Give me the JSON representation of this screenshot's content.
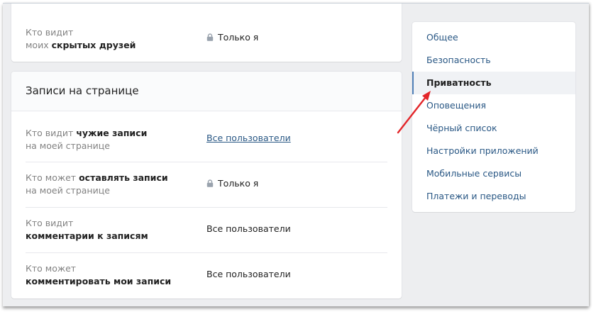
{
  "top_section": {
    "row": {
      "label_line1": "Кто видит",
      "label_prefix": "моих",
      "label_bold": "скрытых друзей",
      "value": "Только я",
      "value_icon": "lock-icon"
    }
  },
  "posts_section": {
    "title": "Записи на странице",
    "rows": [
      {
        "line1_prefix": "Кто видит",
        "line1_bold": "чужие записи",
        "line2": "на моей странице",
        "value": "Все пользователи",
        "value_style": "link"
      },
      {
        "line1_prefix": "Кто может",
        "line1_bold": "оставлять записи",
        "line2": "на моей странице",
        "value": "Только я",
        "value_icon": "lock-icon"
      },
      {
        "line1": "Кто видит",
        "line2_bold": "комментарии к записям",
        "value": "Все пользователи"
      },
      {
        "line1": "Кто может",
        "line2_bold": "комментировать мои записи",
        "value": "Все пользователи"
      }
    ]
  },
  "settings_menu": {
    "items": [
      {
        "label": "Общее"
      },
      {
        "label": "Безопасность"
      },
      {
        "label": "Приватность",
        "active": true
      },
      {
        "label": "Оповещения"
      },
      {
        "label": "Чёрный список"
      },
      {
        "label": "Настройки приложений"
      },
      {
        "label": "Мобильные сервисы"
      },
      {
        "label": "Платежи и переводы"
      }
    ]
  },
  "colors": {
    "link": "#2a5885",
    "active_indicator": "#5181b8",
    "annotation_arrow": "#e3262a"
  }
}
